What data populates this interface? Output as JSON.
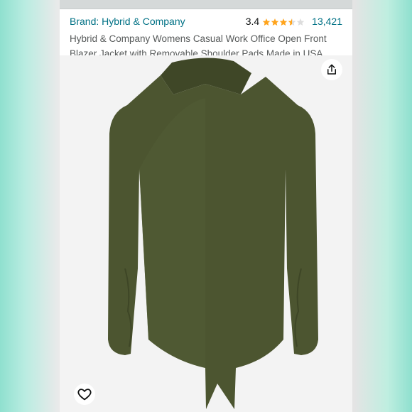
{
  "listing": {
    "brand": "Brand: Hybrid & Company",
    "rating": "3.4",
    "stars_value": 3.4,
    "stars_max": 5,
    "review_count": "13,421",
    "title": "Hybrid & Company Womens Casual Work Office Open Front Blazer Jacket with Removable Shoulder Pads Made in USA"
  },
  "icons": {
    "share": "share-icon",
    "heart": "heart-icon",
    "star": "star-icon"
  },
  "colors": {
    "link": "#007185",
    "star": "#ffa41c",
    "jacket": "#4c5530",
    "text_secondary": "#565959"
  }
}
